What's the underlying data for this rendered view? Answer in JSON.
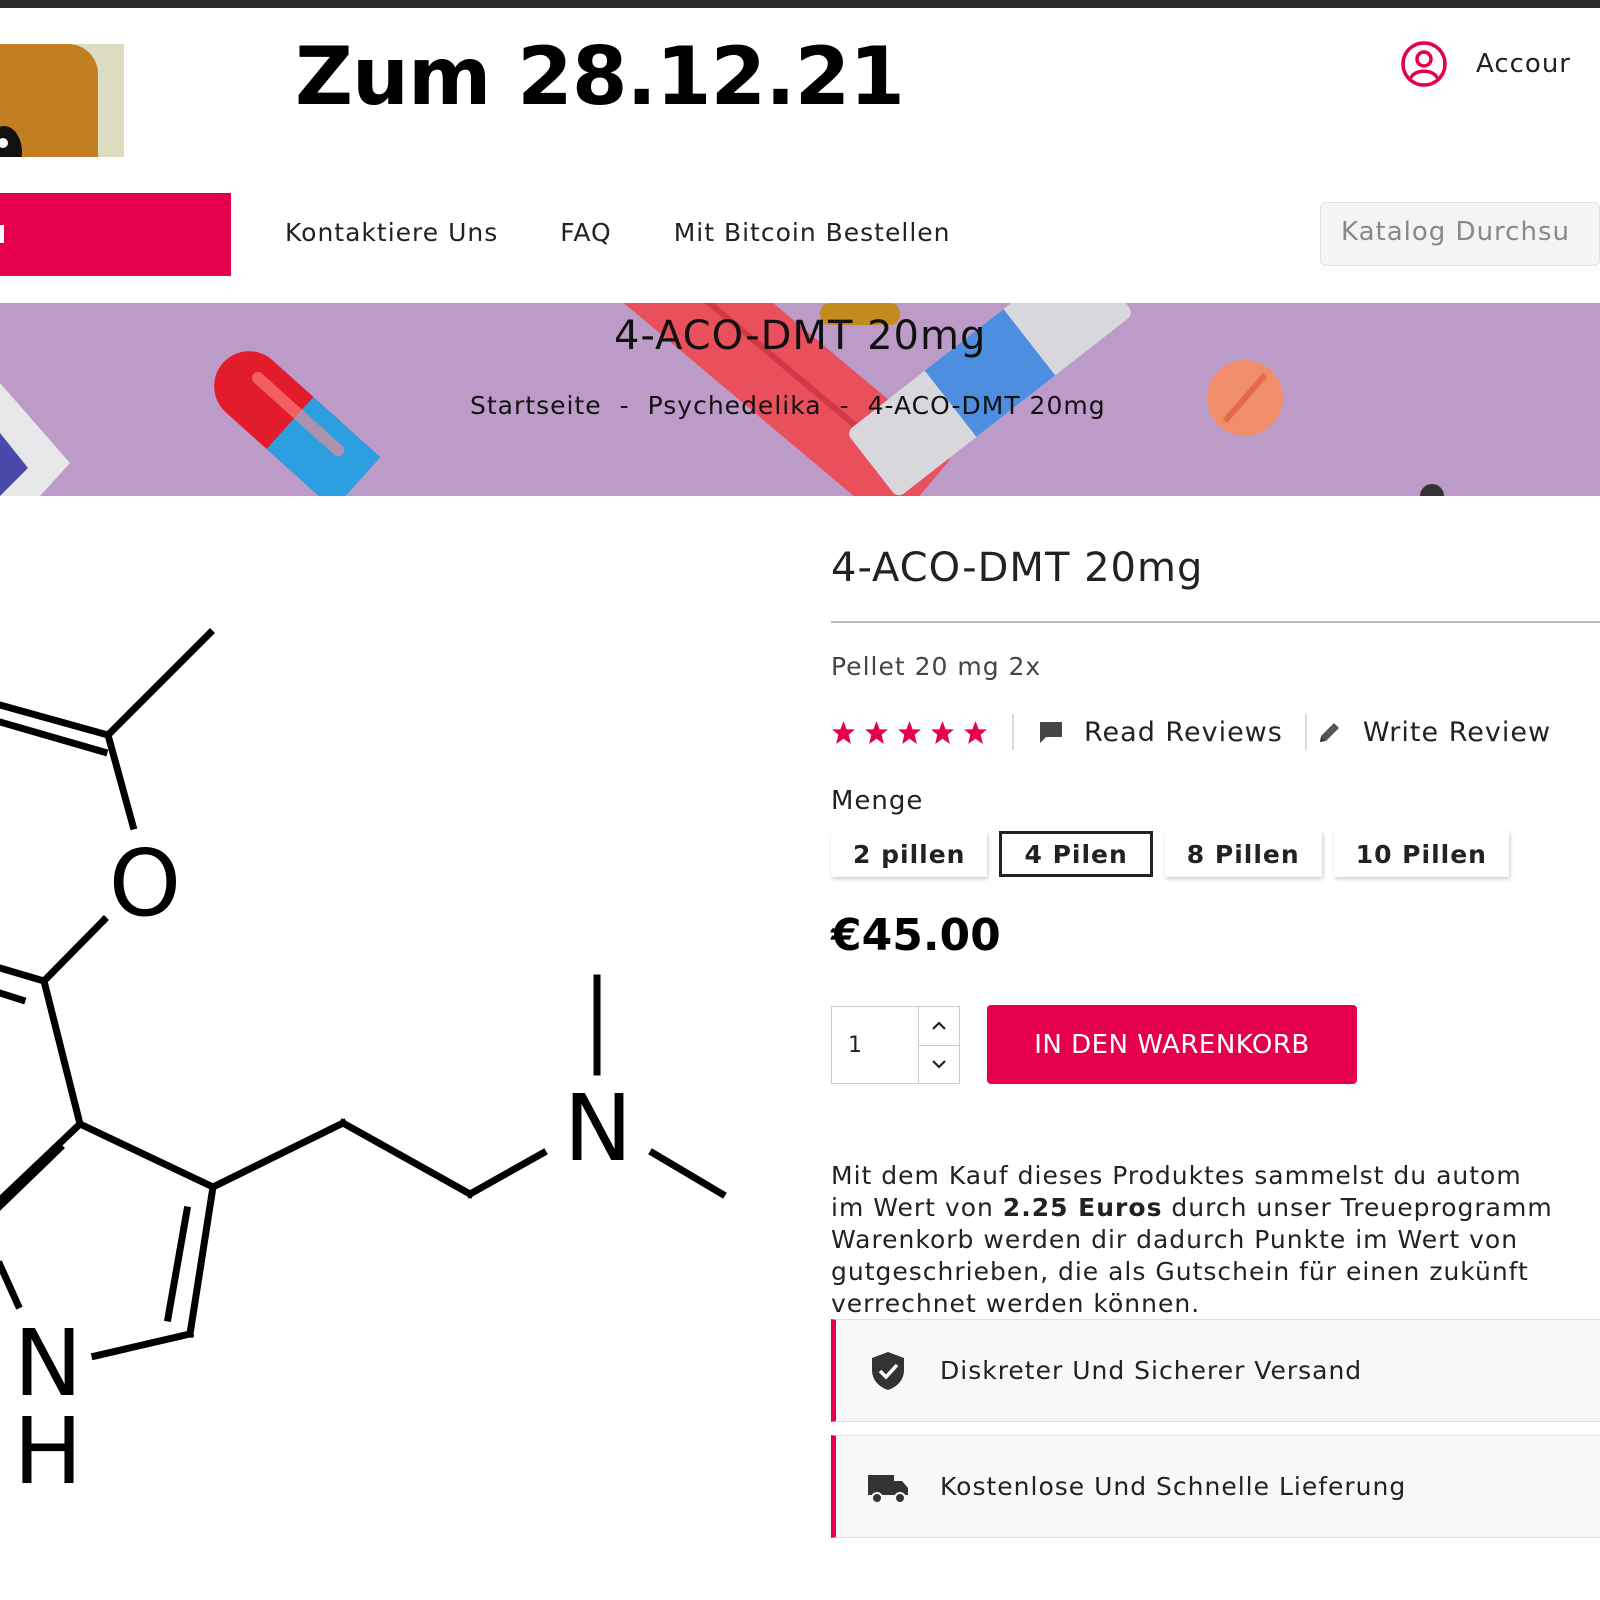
{
  "header": {
    "headline": "Zum 28.12.21",
    "account_label": "Accour"
  },
  "nav": {
    "links": [
      "Kontaktiere Uns",
      "FAQ",
      "Mit Bitcoin Bestellen"
    ],
    "search_placeholder": "Katalog Durchsu"
  },
  "banner": {
    "title": "4-ACO-DMT 20mg",
    "breadcrumb": [
      "Startseite",
      "Psychedelika",
      "4-ACO-DMT 20mg"
    ],
    "separator": "-"
  },
  "product": {
    "title": "4-ACO-DMT 20mg",
    "subtitle": "Pellet 20 mg 2x",
    "rating": 5,
    "rating_max": 5,
    "read_reviews": "Read Reviews",
    "write_review": "Write Review",
    "quantity_label": "Menge",
    "options": [
      "2 pillen",
      "4 Pilen",
      "8 Pillen",
      "10 Pillen"
    ],
    "selected_option": "4 Pilen",
    "price": "€45.00",
    "quantity": "1",
    "add_to_cart": "IN DEN WARENKORB",
    "loyalty": {
      "line1": "Mit dem Kauf dieses Produktes sammelst du autom",
      "line2_pre": "im Wert von ",
      "line2_bold": "2.25 Euros",
      "line2_post": " durch unser Treueprogramm",
      "line3": "Warenkorb werden dir dadurch Punkte im Wert von",
      "line4": "gutgeschrieben, die als Gutschein für einen zukünft",
      "line5": "verrechnet werden können."
    },
    "features": [
      "Diskreter Und Sicherer Versand",
      "Kostenlose Und Schnelle Lieferung"
    ]
  },
  "molecule_labels": {
    "oxygen": "O",
    "nitrogen": "N",
    "nh_n": "N",
    "nh_h": "H"
  },
  "colors": {
    "accent": "#e4004f",
    "banner_bg": "#bd9bc8",
    "topbar": "#2b2b2b"
  },
  "icons": [
    "user-circle-icon",
    "star-icon",
    "comment-icon",
    "pencil-icon",
    "chevron-up-icon",
    "chevron-down-icon",
    "shield-check-icon",
    "truck-icon"
  ]
}
